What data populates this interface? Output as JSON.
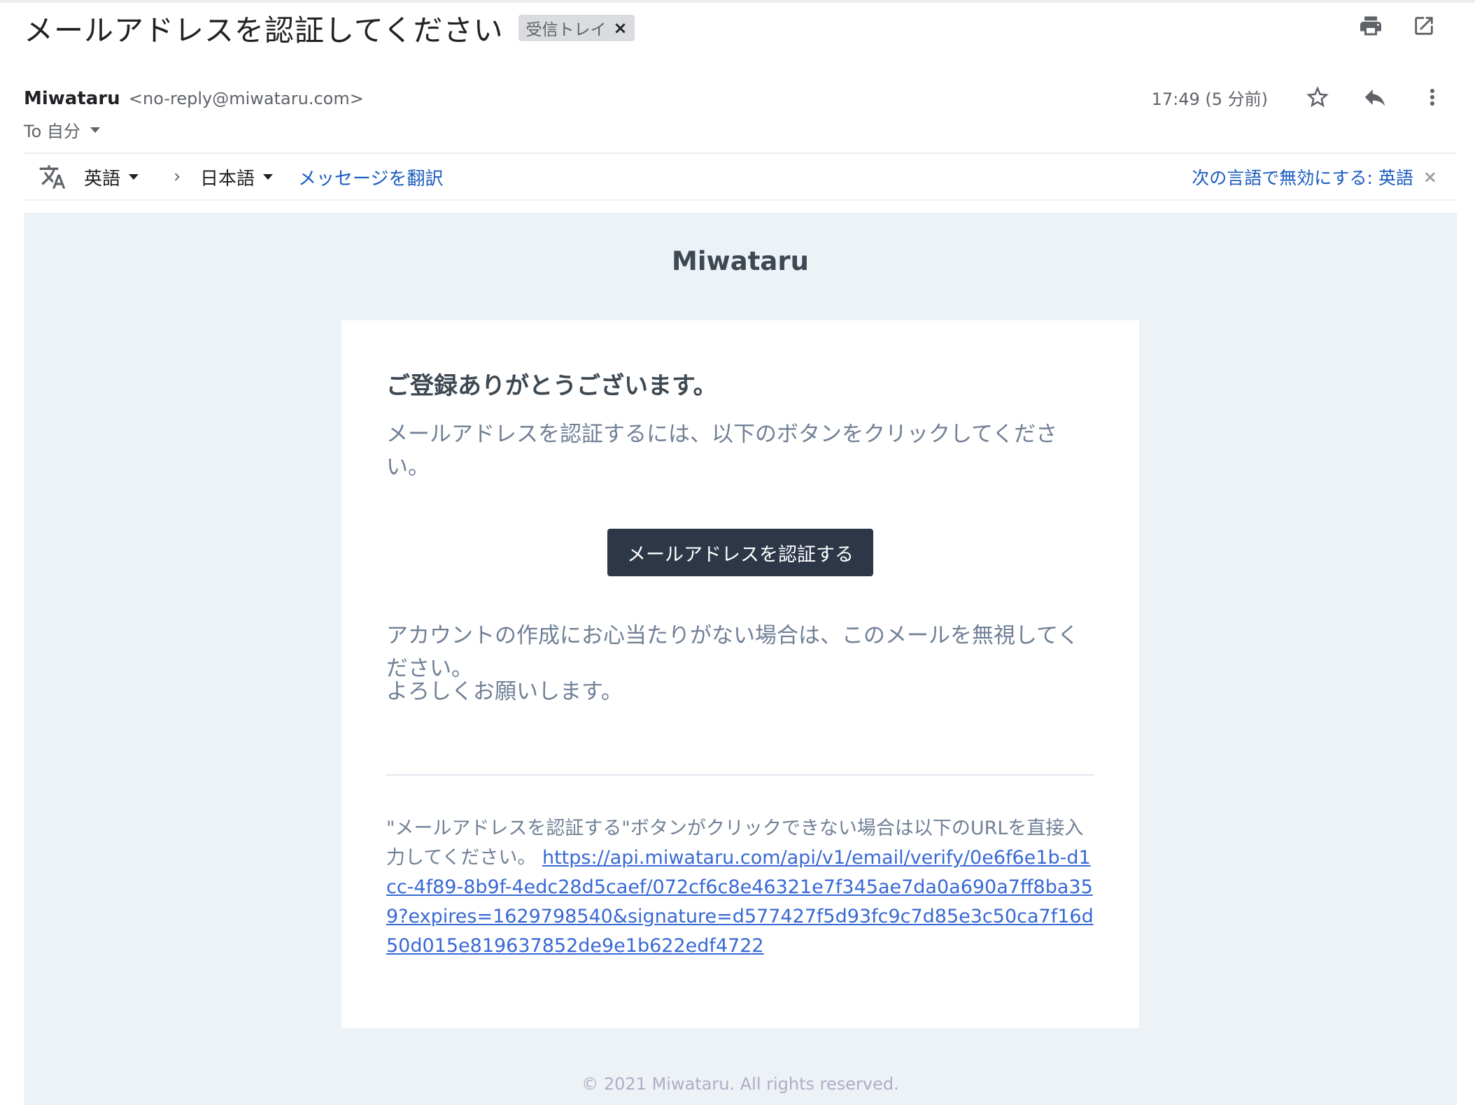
{
  "header": {
    "subject": "メールアドレスを認証してください",
    "label": "受信トレイ",
    "label_close": "×"
  },
  "sender": {
    "name": "Miwataru",
    "email": "<no-reply@miwataru.com>",
    "to": "To 自分",
    "time": "17:49 (5 分前)"
  },
  "translate": {
    "from_lang": "英語",
    "to_lang": "日本語",
    "translate_link": "メッセージを翻訳",
    "disable_link": "次の言語で無効にする: 英語",
    "disable_close": "×"
  },
  "email": {
    "brand": "Miwataru",
    "greeting": "ご登録ありがとうございます。",
    "instruction": "メールアドレスを認証するには、以下のボタンをクリックしてください。",
    "button_label": "メールアドレスを認証する",
    "ignore_note": "アカウントの作成にお心当たりがない場合は、このメールを無視してください。",
    "regards": "よろしくお願いします。",
    "fallback_text": "\"メールアドレスを認証する\"ボタンがクリックできない場合は以下のURLを直接入力してください。 ",
    "fallback_url": "https://api.miwataru.com/api/v1/email/verify/0e6f6e1b-d1cc-4f89-8b9f-4edc28d5caef/072cf6c8e46321e7f345ae7da0a690a7ff8ba359?expires=1629798540&signature=d577427f5d93fc9c7d85e3c50ca7f16d50d015e819637852de9e1b622edf4722",
    "footer": "© 2021 Miwataru. All rights reserved."
  },
  "icons": {
    "print": "print-icon",
    "open_new_window": "open-in-new-window-icon",
    "star": "star-icon",
    "reply": "reply-icon",
    "more": "more-vert-icon",
    "translate": "translate-icon",
    "chevron_right": "chevron-right-icon"
  },
  "colors": {
    "link": "#1a5bbf",
    "button_bg": "#2d3748",
    "body_bg": "#edf2f7",
    "url_link": "#3869d4"
  }
}
